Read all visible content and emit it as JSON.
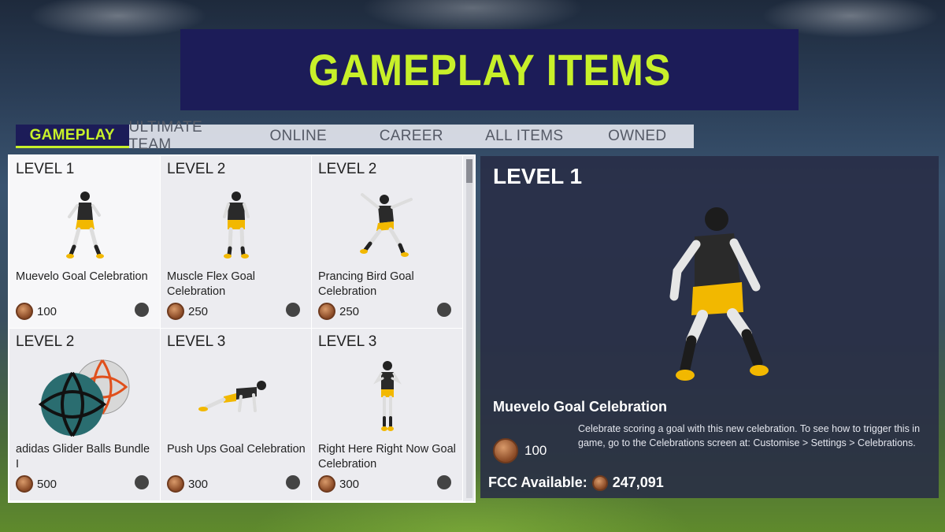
{
  "banner": {
    "title": "GAMEPLAY ITEMS"
  },
  "tabs": [
    {
      "label": "GAMEPLAY"
    },
    {
      "label": "ULTIMATE TEAM"
    },
    {
      "label": "ONLINE"
    },
    {
      "label": "CAREER"
    },
    {
      "label": "ALL ITEMS"
    },
    {
      "label": "OWNED"
    }
  ],
  "items": [
    {
      "level": "LEVEL 1",
      "name": "Muevelo Goal Celebration",
      "price": "100",
      "icon": "player-celebration-icon"
    },
    {
      "level": "LEVEL 2",
      "name": "Muscle Flex Goal Celebration",
      "price": "250",
      "icon": "player-celebration-icon"
    },
    {
      "level": "LEVEL 2",
      "name": "Prancing Bird Goal Celebration",
      "price": "250",
      "icon": "player-celebration-icon"
    },
    {
      "level": "LEVEL 2",
      "name": "adidas Glider Balls Bundle I",
      "price": "500",
      "icon": "football-icon"
    },
    {
      "level": "LEVEL 3",
      "name": "Push Ups Goal Celebration",
      "price": "300",
      "icon": "player-celebration-icon"
    },
    {
      "level": "LEVEL 3",
      "name": "Right Here Right Now Goal Celebration",
      "price": "300",
      "icon": "player-celebration-icon"
    }
  ],
  "detail": {
    "level": "LEVEL 1",
    "name": "Muevelo Goal Celebration",
    "price": "100",
    "description": "Celebrate scoring a goal with this new celebration.  To see how to trigger this in game, go to the Celebrations screen at: Customise > Settings > Celebrations."
  },
  "fcc": {
    "label": "FCC Available:",
    "value": "247,091"
  },
  "colors": {
    "accent": "#c8f02a",
    "banner": "#1c1c58",
    "coin": "#a05a30"
  }
}
